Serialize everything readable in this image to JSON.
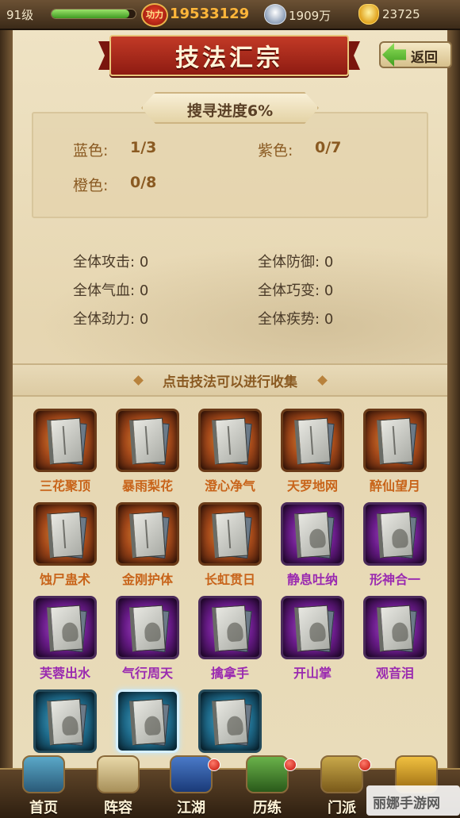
{
  "topbar": {
    "level": "91级",
    "exp_fraction": 0.92,
    "power_label": "功力",
    "power": "19533129",
    "silver": "1909万",
    "gold": "23725"
  },
  "page": {
    "title": "技法汇宗",
    "back_label": "返回"
  },
  "progress": {
    "label": "搜寻进度6%",
    "blue_label": "蓝色:",
    "blue_value": "1/3",
    "purple_label": "紫色:",
    "purple_value": "0/7",
    "orange_label": "橙色:",
    "orange_value": "0/8"
  },
  "attributes": [
    {
      "label": "全体攻击:",
      "value": "0"
    },
    {
      "label": "全体防御:",
      "value": "0"
    },
    {
      "label": "全体气血:",
      "value": "0"
    },
    {
      "label": "全体巧变:",
      "value": "0"
    },
    {
      "label": "全体劲力:",
      "value": "0"
    },
    {
      "label": "全体疾势:",
      "value": "0"
    }
  ],
  "collect_hint": "点击技法可以进行收集",
  "skills": [
    {
      "name": "三花聚顶",
      "rarity": "orange"
    },
    {
      "name": "暴雨梨花",
      "rarity": "orange"
    },
    {
      "name": "澄心净气",
      "rarity": "orange"
    },
    {
      "name": "天罗地网",
      "rarity": "orange"
    },
    {
      "name": "醉仙望月",
      "rarity": "orange"
    },
    {
      "name": "蚀尸蛊术",
      "rarity": "orange"
    },
    {
      "name": "金刚护体",
      "rarity": "orange"
    },
    {
      "name": "长虹贯日",
      "rarity": "orange"
    },
    {
      "name": "静息吐纳",
      "rarity": "purple"
    },
    {
      "name": "形神合一",
      "rarity": "purple"
    },
    {
      "name": "芙蓉出水",
      "rarity": "purple"
    },
    {
      "name": "气行周天",
      "rarity": "purple"
    },
    {
      "name": "擒拿手",
      "rarity": "purple"
    },
    {
      "name": "开山掌",
      "rarity": "purple"
    },
    {
      "name": "观音泪",
      "rarity": "purple"
    },
    {
      "name": "",
      "rarity": "blue"
    },
    {
      "name": "",
      "rarity": "blue",
      "selected": true
    },
    {
      "name": "",
      "rarity": "blue"
    }
  ],
  "nav": [
    {
      "label": "首页",
      "icon": "home-icon",
      "badge": false
    },
    {
      "label": "阵容",
      "icon": "formation-icon",
      "badge": false
    },
    {
      "label": "江湖",
      "icon": "jianghu-icon",
      "badge": true
    },
    {
      "label": "历练",
      "icon": "training-icon",
      "badge": true
    },
    {
      "label": "门派",
      "icon": "sect-icon",
      "badge": true
    },
    {
      "label": "",
      "icon": "treasure-icon",
      "badge": false
    }
  ],
  "watermark": "丽娜手游网",
  "colors": {
    "orange_rarity": "#c8641a",
    "purple_rarity": "#9a2ab0",
    "blue_rarity": "#2a7ab0",
    "power": "#ffb63a"
  }
}
